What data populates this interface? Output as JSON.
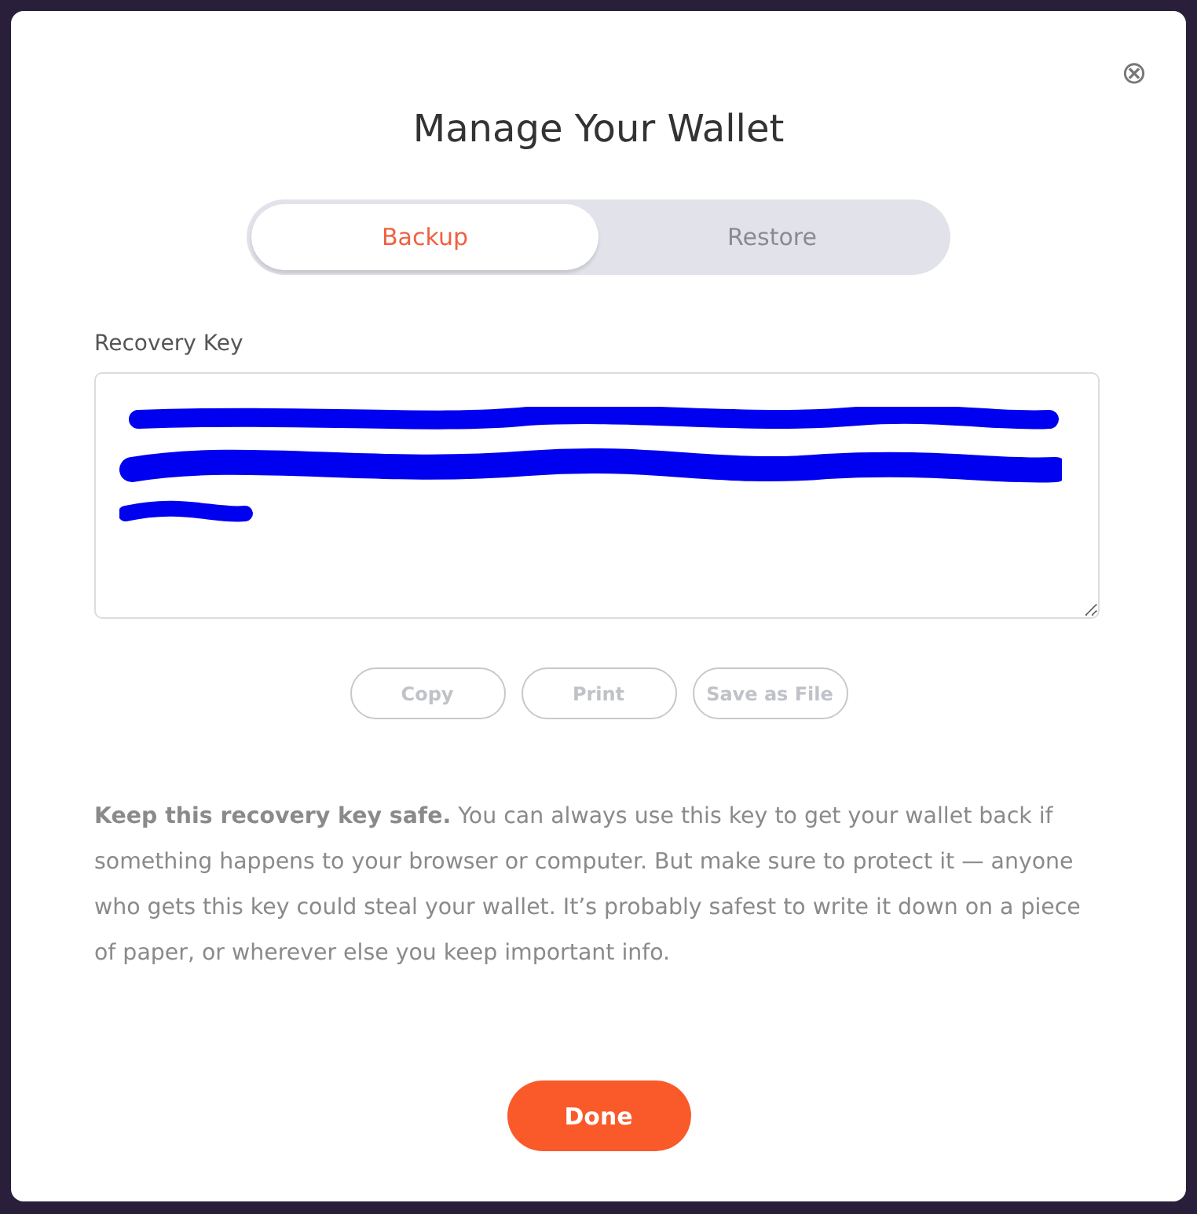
{
  "dialog": {
    "title": "Manage Your Wallet",
    "close_icon": "⊗"
  },
  "tabs": [
    {
      "label": "Backup",
      "selected": true
    },
    {
      "label": "Restore",
      "selected": false
    }
  ],
  "recovery_key": {
    "label": "Recovery Key"
  },
  "actions": [
    {
      "label": "Copy",
      "disabled": true
    },
    {
      "label": "Print",
      "disabled": true
    },
    {
      "label": "Save as File",
      "disabled": true
    }
  ],
  "notice": "**Keep this recovery key safe.** You can always use this key to get your wallet back if something happens to your browser or computer. But make sure to protect it — anyone who gets this key could steal your wallet. It’s probably safest to write it down on a piece of paper, or wherever else you keep important info.",
  "done_button": "Done"
}
